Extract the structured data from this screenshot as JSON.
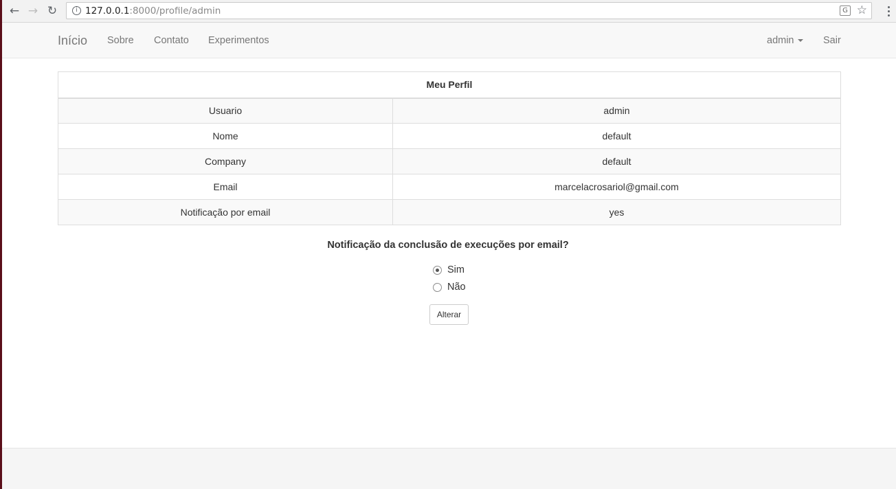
{
  "browser": {
    "url_host": "127.0.0.1",
    "url_rest": ":8000/profile/admin"
  },
  "navbar": {
    "brand": "Início",
    "links": [
      "Sobre",
      "Contato",
      "Experimentos"
    ],
    "user_menu": "admin",
    "logout": "Sair"
  },
  "profile": {
    "title": "Meu Perfil",
    "rows": [
      {
        "label": "Usuario",
        "value": "admin"
      },
      {
        "label": "Nome",
        "value": "default"
      },
      {
        "label": "Company",
        "value": "default"
      },
      {
        "label": "Email",
        "value": "marcelacrosariol@gmail.com"
      },
      {
        "label": "Notificação por email",
        "value": "yes"
      }
    ]
  },
  "form": {
    "question": "Notificação da conclusão de execuções por email?",
    "options": [
      {
        "label": "Sim",
        "checked": true
      },
      {
        "label": "Não",
        "checked": false
      }
    ],
    "submit_label": "Alterar"
  }
}
